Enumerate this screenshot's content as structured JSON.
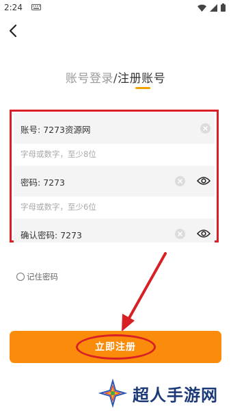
{
  "status_bar": {
    "time": "2:24"
  },
  "tabs": {
    "login": "账号登录",
    "separator": "/",
    "register": "注册账号"
  },
  "form": {
    "account": {
      "label": "账号",
      "value": "7273资源网",
      "hint": "字母或数字，至少8位"
    },
    "password": {
      "label": "密码",
      "value": "7273",
      "hint": "字母或数字，至少6位"
    },
    "confirm": {
      "label": "确认密码",
      "value": "7273"
    }
  },
  "remember": {
    "label": "记住密码"
  },
  "submit": {
    "label": "立即注册"
  },
  "watermark": {
    "text": "超人手游网"
  },
  "colors": {
    "accent": "#fb8b0a",
    "annotation": "#d81f26",
    "title_underline": "#f2a000"
  },
  "icons": [
    "keyboard-icon",
    "wifi-icon",
    "signal-icon",
    "battery-icon",
    "back-arrow-icon",
    "clear-icon",
    "eye-icon"
  ]
}
